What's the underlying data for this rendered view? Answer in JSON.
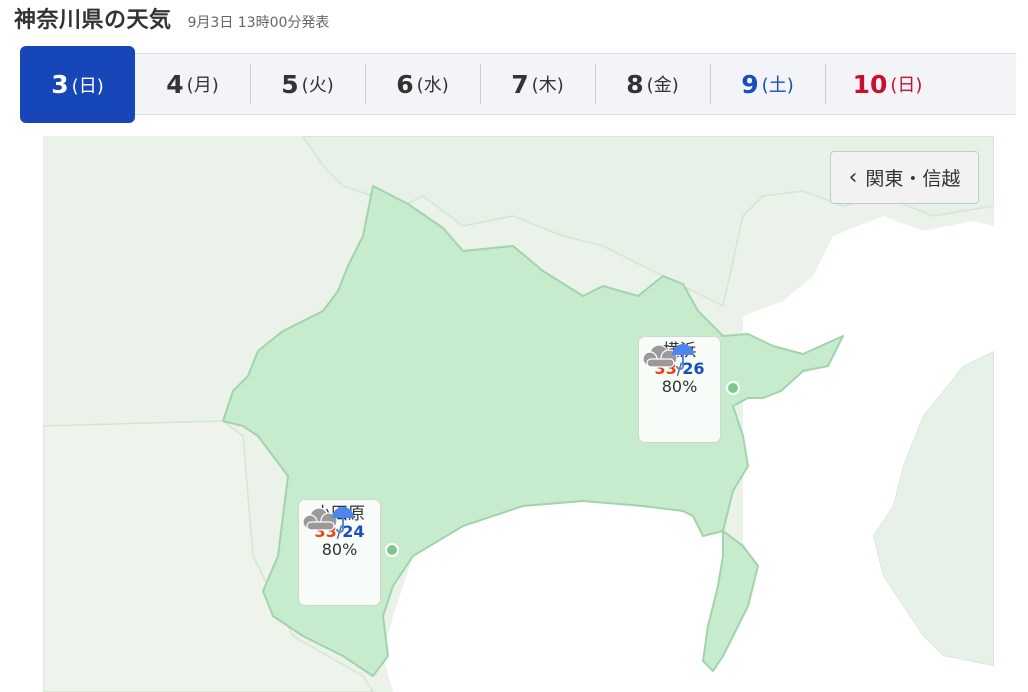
{
  "header": {
    "title": "神奈川県の天気",
    "issued": "9月3日 13時00分発表"
  },
  "tabs": [
    {
      "num": "3",
      "dow": "(日)",
      "active": true
    },
    {
      "num": "4",
      "dow": "(月)"
    },
    {
      "num": "5",
      "dow": "(火)"
    },
    {
      "num": "6",
      "dow": "(水)"
    },
    {
      "num": "7",
      "dow": "(木)"
    },
    {
      "num": "8",
      "dow": "(金)"
    },
    {
      "num": "9",
      "dow": "(土)"
    },
    {
      "num": "10",
      "dow": "(日)"
    }
  ],
  "map": {
    "region_button": {
      "label": "関東・信越",
      "icon": "chevron-left-icon"
    },
    "cities": [
      {
        "name": "横浜",
        "high": "33",
        "low": "26",
        "pop": "80%",
        "icon": "cloudy-with-rain-icon"
      },
      {
        "name": "小田原",
        "high": "33",
        "low": "24",
        "pop": "80%",
        "icon": "cloudy-with-rain-icon"
      }
    ]
  },
  "colors": {
    "active_tab": "#1646b8",
    "saturday": "#1a4dbd",
    "sunday": "#c8102e",
    "high_temp": "#e8411b",
    "low_temp": "#1a4dbd",
    "land": "#c6eccd",
    "sea": "#ffffff"
  }
}
